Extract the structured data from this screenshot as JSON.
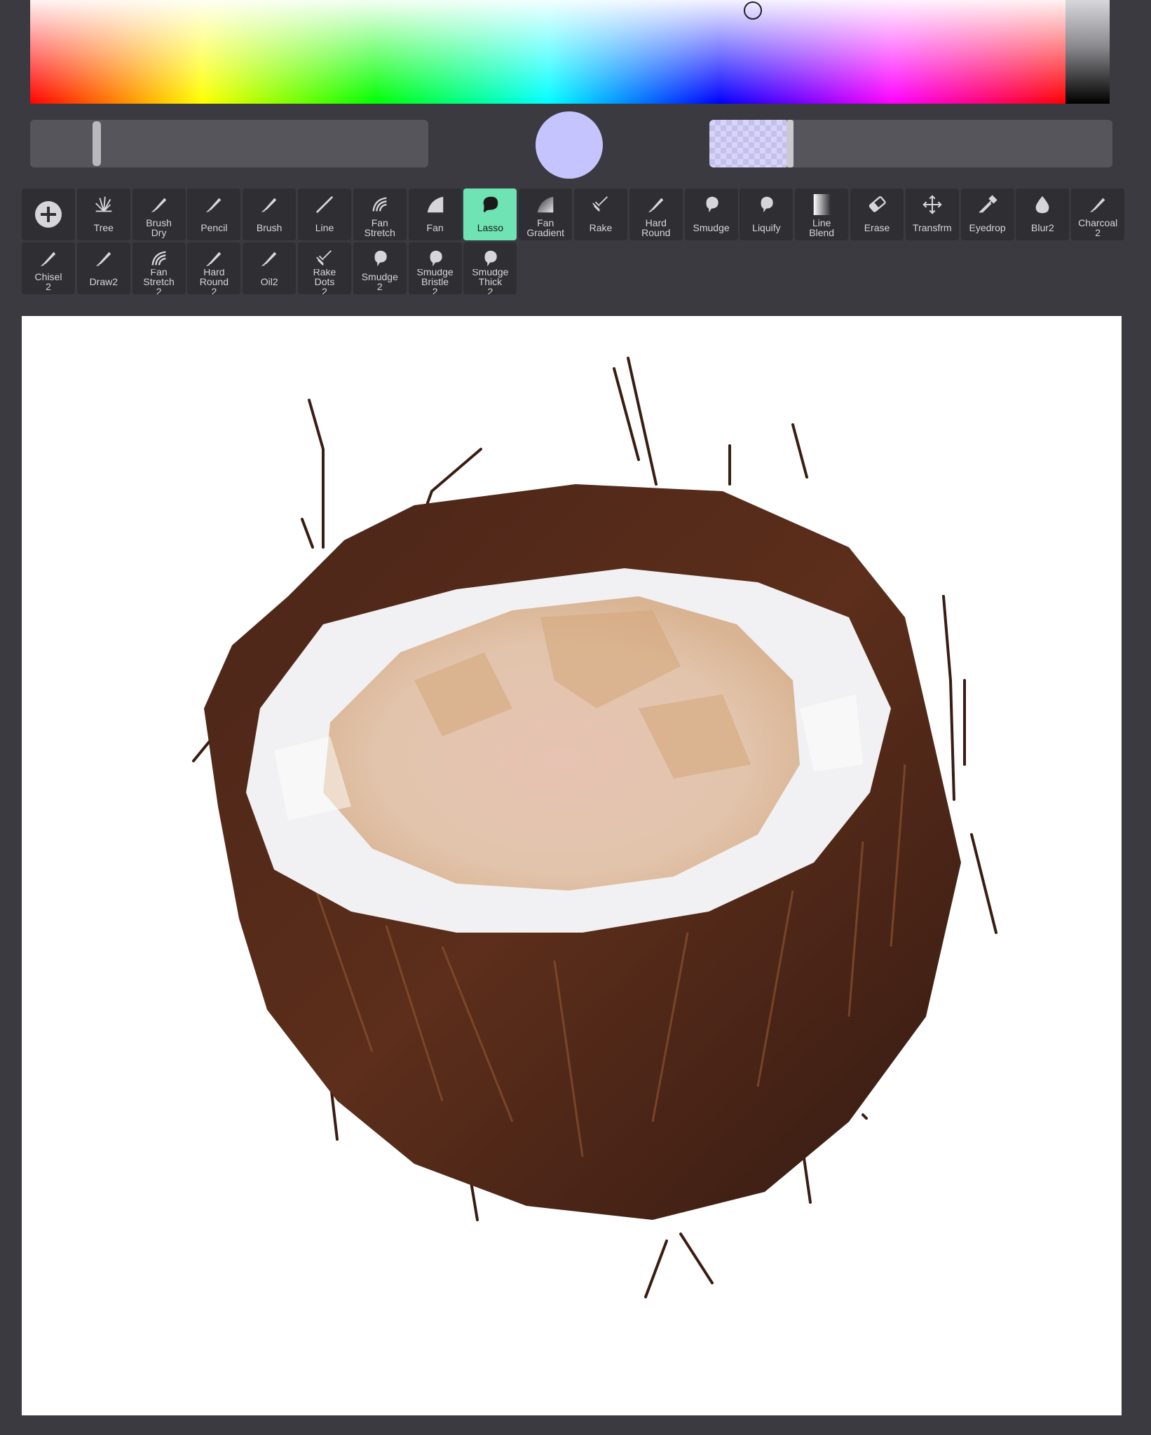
{
  "color_picker": {
    "current_color": "#c6c4fe",
    "accent_color": "#6fe3b3"
  },
  "toolbar": {
    "add_brush_icon": "plus-circle-icon",
    "active_tool": "Lasso",
    "row1": [
      {
        "id": "tree",
        "label": "Tree",
        "icon": "tree-brush-icon"
      },
      {
        "id": "brush-dry",
        "label": "Brush\nDry",
        "icon": "brush-icon"
      },
      {
        "id": "pencil",
        "label": "Pencil",
        "icon": "brush-icon"
      },
      {
        "id": "brush",
        "label": "Brush",
        "icon": "brush-icon"
      },
      {
        "id": "line",
        "label": "Line",
        "icon": "line-icon"
      },
      {
        "id": "fan-stretch",
        "label": "Fan\nStretch",
        "icon": "fan-stretch-icon"
      },
      {
        "id": "fan",
        "label": "Fan",
        "icon": "fan-icon"
      },
      {
        "id": "lasso",
        "label": "Lasso",
        "icon": "lasso-icon"
      },
      {
        "id": "fan-gradient",
        "label": "Fan\nGradient",
        "icon": "fan-gradient-icon"
      },
      {
        "id": "rake",
        "label": "Rake",
        "icon": "rake-icon"
      },
      {
        "id": "hard-round",
        "label": "Hard\nRound",
        "icon": "brush-icon"
      },
      {
        "id": "smudge",
        "label": "Smudge",
        "icon": "smudge-icon"
      },
      {
        "id": "liquify",
        "label": "Liquify",
        "icon": "smudge-icon"
      },
      {
        "id": "line-blend",
        "label": "Line\nBlend",
        "icon": "line-blend-icon"
      },
      {
        "id": "erase",
        "label": "Erase",
        "icon": "eraser-icon"
      },
      {
        "id": "transfrm",
        "label": "Transfrm",
        "icon": "transform-icon"
      },
      {
        "id": "eyedrop",
        "label": "Eyedrop",
        "icon": "eyedropper-icon"
      },
      {
        "id": "blur2",
        "label": "Blur2",
        "icon": "blur-drop-icon"
      },
      {
        "id": "charcoal-2",
        "label": "Charcoal\n2",
        "icon": "brush-icon"
      }
    ],
    "row2": [
      {
        "id": "chisel-2",
        "label": "Chisel\n2",
        "icon": "brush-icon"
      },
      {
        "id": "draw2",
        "label": "Draw2",
        "icon": "brush-icon"
      },
      {
        "id": "fan-stretch-2",
        "label": "Fan\nStretch\n2",
        "icon": "fan-stretch-icon"
      },
      {
        "id": "hard-round-2",
        "label": "Hard\nRound\n2",
        "icon": "brush-icon"
      },
      {
        "id": "oil2",
        "label": "Oil2",
        "icon": "brush-icon"
      },
      {
        "id": "rake-dots-2",
        "label": "Rake\nDots\n2",
        "icon": "rake-icon"
      },
      {
        "id": "smudge-2",
        "label": "Smudge\n2",
        "icon": "smudge-icon"
      },
      {
        "id": "smudge-bristle-2",
        "label": "Smudge\nBristle\n2",
        "icon": "smudge-icon"
      },
      {
        "id": "smudge-thick-2",
        "label": "Smudge\nThick\n2",
        "icon": "smudge-icon"
      }
    ]
  },
  "canvas": {
    "subject": "coconut-painting"
  }
}
